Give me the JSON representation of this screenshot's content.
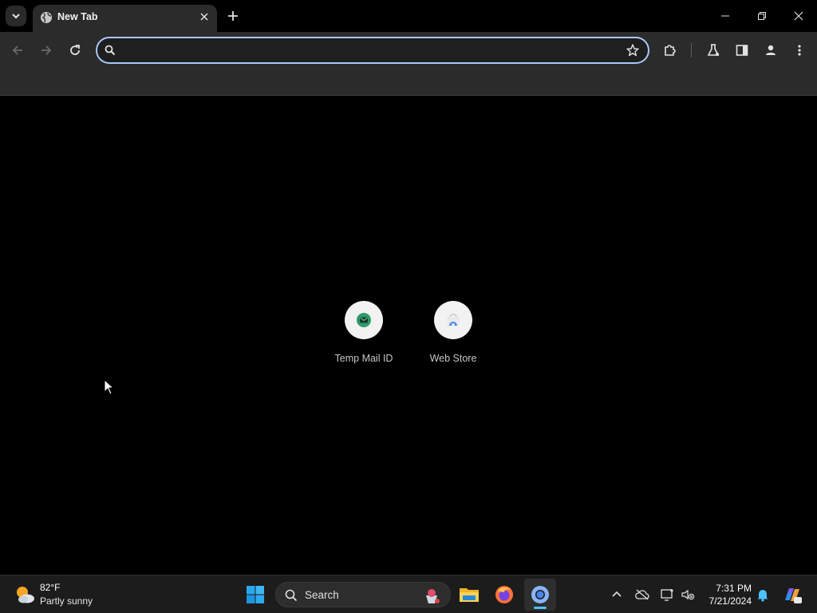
{
  "browser": {
    "tab": {
      "title": "New Tab"
    },
    "omnibox": {
      "value": "",
      "placeholder": ""
    }
  },
  "shortcuts": [
    {
      "label": "Temp Mail ID",
      "icon": "mail-icon"
    },
    {
      "label": "Web Store",
      "icon": "web-store-icon"
    }
  ],
  "taskbar": {
    "weather": {
      "temp": "82°F",
      "desc": "Partly sunny"
    },
    "search_label": "Search",
    "clock": {
      "time": "7:31 PM",
      "date": "7/21/2024"
    }
  },
  "colors": {
    "accent": "#a8c7fa",
    "taskbar_indicator": "#4cc2ff",
    "page_background": "#000000",
    "toolbar_background": "#2b2b2b"
  }
}
